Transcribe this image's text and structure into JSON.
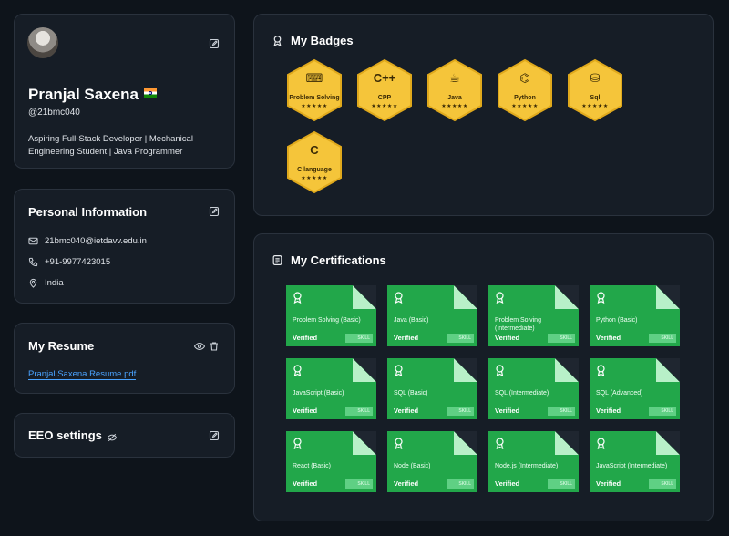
{
  "profile": {
    "name": "Pranjal Saxena",
    "handle": "@21bmc040",
    "bio": "Aspiring Full-Stack Developer | Mechanical Engineering Student | Java Programmer"
  },
  "personal": {
    "title": "Personal Information",
    "email": "21bmc040@ietdavv.edu.in",
    "phone": "+91-9977423015",
    "location": "India"
  },
  "resume": {
    "title": "My Resume",
    "file": "Pranjal Saxena Resume.pdf"
  },
  "eeo": {
    "title": "EEO settings"
  },
  "badges": {
    "title": "My Badges",
    "items": [
      {
        "label": "Problem Solving",
        "icon": "keyboard-icon",
        "glyph": "⌨",
        "stars": "★★★★★"
      },
      {
        "label": "CPP",
        "icon": "cpp-icon",
        "glyph": "C++",
        "stars": "★★★★★"
      },
      {
        "label": "Java",
        "icon": "java-icon",
        "glyph": "☕",
        "stars": "★★★★★"
      },
      {
        "label": "Python",
        "icon": "python-icon",
        "glyph": "⌬",
        "stars": "★★★★★"
      },
      {
        "label": "Sql",
        "icon": "database-icon",
        "glyph": "⛁",
        "stars": "★★★★★"
      },
      {
        "label": "C language",
        "icon": "c-icon",
        "glyph": "C",
        "stars": "★★★★★"
      }
    ]
  },
  "certifications": {
    "title": "My Certifications",
    "status": "Verified",
    "tag": "SKILL",
    "items": [
      "Problem Solving (Basic)",
      "Java (Basic)",
      "Problem Solving (Intermediate)",
      "Python (Basic)",
      "JavaScript (Basic)",
      "SQL (Basic)",
      "SQL (Intermediate)",
      "SQL (Advanced)",
      "React (Basic)",
      "Node (Basic)",
      "Node.js (Intermediate)",
      "JavaScript (Intermediate)"
    ]
  },
  "colors": {
    "background": "#0e141b",
    "card": "#161d26",
    "badge_gold": "#f5c53a",
    "cert_green": "#22a74a",
    "link": "#4aa3ff"
  }
}
